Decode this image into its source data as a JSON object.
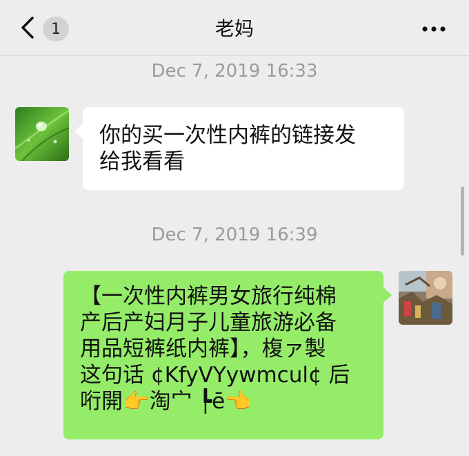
{
  "header": {
    "back_icon": "chevron-left-icon",
    "unread_count": "1",
    "title": "老妈",
    "more_icon": "more-dots-icon"
  },
  "messages": [
    {
      "timestamp": "Dec 7, 2019 16:33",
      "direction": "incoming",
      "avatar": "green-leaf-water-drop-image",
      "lines": [
        "你的买一次性内裤的链接发",
        "给我看看"
      ]
    },
    {
      "timestamp": "Dec 7, 2019 16:39",
      "direction": "outgoing",
      "avatar": "colorful-painting-image",
      "lines": [
        "【一次性内裤男女旅行纯棉",
        "产后产妇月子儿童旅游必备",
        "用品短裤纸内裤】，椱ァ製",
        "这句话 ¢KfyVYywmcul¢ 后",
        "哘開👉淘宀 ┡ē👈"
      ]
    }
  ],
  "colors": {
    "background": "#ededed",
    "incoming_bubble": "#ffffff",
    "outgoing_bubble": "#95ec69",
    "timestamp_text": "#9b9b9b"
  }
}
